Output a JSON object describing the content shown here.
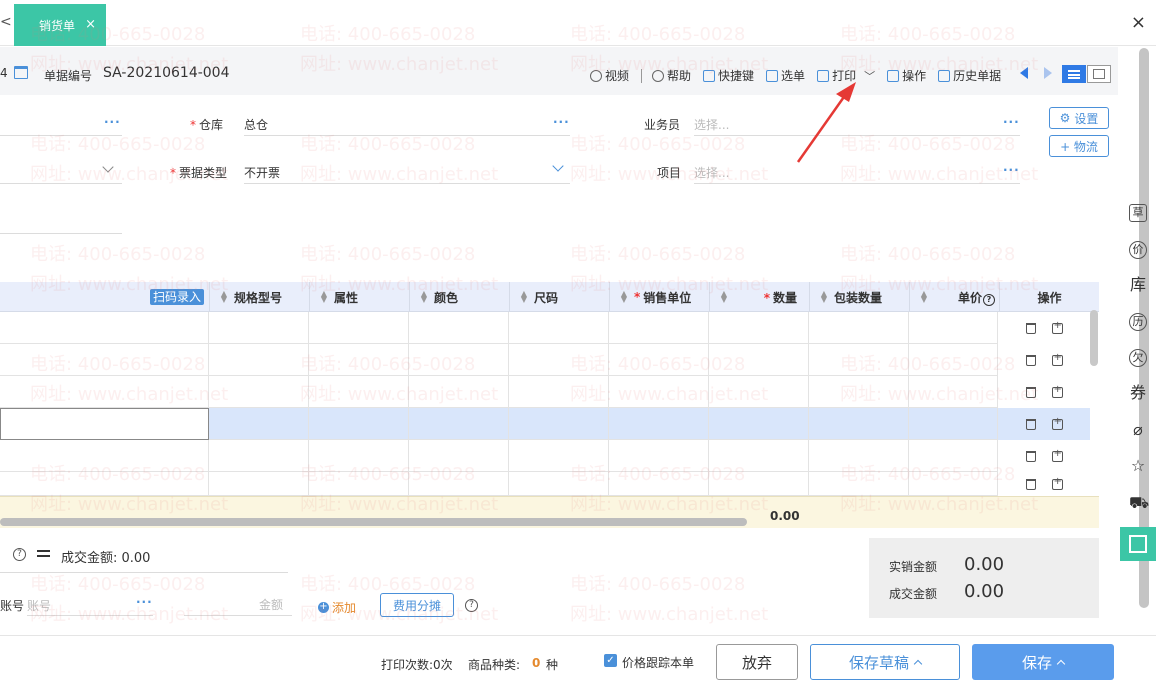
{
  "tabs": {
    "prev_glyph": "<",
    "active_label": "销货单",
    "close_glyph": "×",
    "window_close_glyph": "×"
  },
  "doc": {
    "number_edge": "4",
    "number_label": "单据编号",
    "number_value": "SA-20210614-004"
  },
  "toolbar": {
    "video": "视频",
    "help": "帮助",
    "shortcut": "快捷键",
    "select_order": "选单",
    "print": "打印",
    "operation": "操作",
    "history": "历史单据"
  },
  "form": {
    "warehouse_label": "仓库",
    "warehouse_value": "总仓",
    "salesperson_label": "业务员",
    "salesperson_placeholder": "选择...",
    "invoice_type_label": "票据类型",
    "invoice_type_value": "不开票",
    "project_label": "项目",
    "project_placeholder": "选择...",
    "settings_btn": "设置",
    "logistics_btn": "+ 物流",
    "more_glyph": "···"
  },
  "grid": {
    "scan_btn": "扫码录入",
    "columns": [
      "规格型号",
      "属性",
      "颜色",
      "尺码",
      "销售单位",
      "数量",
      "包装数量",
      "单价",
      "操作"
    ],
    "total_value": "0.00"
  },
  "payment": {
    "deal_amount": "成交金额: 0.00",
    "account_label": "账号",
    "account_placeholder": "账号",
    "amount_placeholder": "金额",
    "add_link": "添加",
    "fee_split_btn": "费用分摊"
  },
  "summary": {
    "actual_label": "实销金额",
    "actual_value": "0.00",
    "deal_label": "成交金额",
    "deal_value": "0.00"
  },
  "sidebar": {
    "icons": [
      {
        "name": "draft-icon",
        "glyph": "草"
      },
      {
        "name": "price-icon",
        "glyph": "价"
      },
      {
        "name": "stock-icon",
        "glyph": "库"
      },
      {
        "name": "history-icon",
        "glyph": "历"
      },
      {
        "name": "debt-icon",
        "glyph": "欠"
      },
      {
        "name": "coupon-icon",
        "glyph": "券"
      }
    ]
  },
  "footer": {
    "print_count": "打印次数:0次",
    "product_kinds_label": "商品种类:",
    "product_kinds_value": "0",
    "product_kinds_unit": "种",
    "price_track_label": "价格跟踪本单",
    "discard_btn": "放弃",
    "save_draft_btn": "保存草稿",
    "save_btn": "保存"
  },
  "watermark": {
    "phone": "电话: 400-665-0028",
    "site": "网址: www.chanjet.net"
  },
  "colors": {
    "tab_active": "#3cc6a6",
    "accent_blue": "#4a90d9",
    "required_red": "#e33333",
    "annotation_red": "#e53935"
  }
}
